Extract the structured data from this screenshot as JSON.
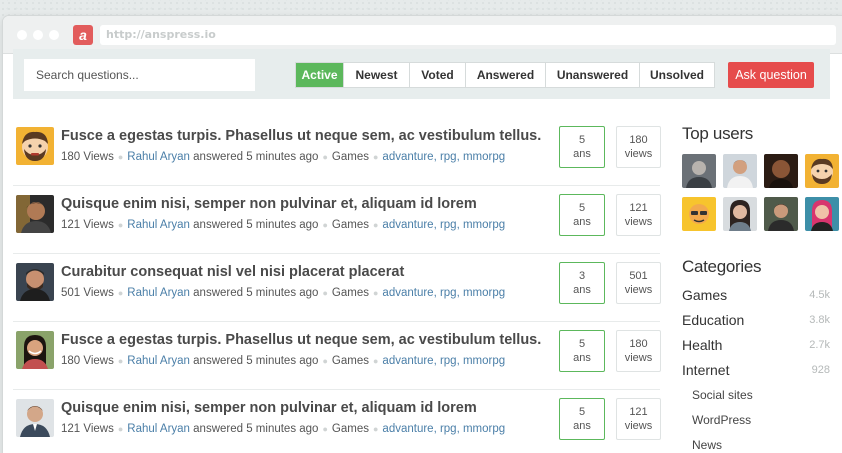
{
  "browser": {
    "url": "http://anspress.io",
    "favicon_letter": "a"
  },
  "toolbar": {
    "search_placeholder": "Search questions...",
    "tabs": [
      {
        "label": "Active",
        "active": true
      },
      {
        "label": "Newest",
        "active": false
      },
      {
        "label": "Voted",
        "active": false
      },
      {
        "label": "Answered",
        "active": false
      },
      {
        "label": "Unanswered",
        "active": false
      },
      {
        "label": "Unsolved",
        "active": false
      }
    ],
    "ask_label": "Ask question"
  },
  "questions": [
    {
      "title": "Fusce a egestas turpis. Phasellus ut neque sem, ac vestibulum tellus.",
      "views_text": "180 Views",
      "author": "Rahul Aryan",
      "action": "answered 5 minutes ago",
      "category": "Games",
      "tags": "advanture, rpg, mmorpg",
      "ans": "5",
      "ans_label": "ans",
      "views": "180",
      "views_label": "views",
      "avatar": "cartoon-face-icon"
    },
    {
      "title": "Quisque enim nisi, semper non pulvinar et, aliquam id lorem",
      "views_text": "121 Views",
      "author": "Rahul Aryan",
      "action": "answered 5 minutes ago",
      "category": "Games",
      "tags": "advanture, rpg, mmorpg",
      "ans": "5",
      "ans_label": "ans",
      "views": "121",
      "views_label": "views",
      "avatar": "man-avatar"
    },
    {
      "title": "Curabitur consequat nisl vel nisi placerat placerat",
      "views_text": "501 Views",
      "author": "Rahul Aryan",
      "action": "answered 5 minutes ago",
      "category": "Games",
      "tags": "advanture, rpg, mmorpg",
      "ans": "3",
      "ans_label": "ans",
      "views": "501",
      "views_label": "views",
      "avatar": "man-avatar"
    },
    {
      "title": "Fusce a egestas turpis. Phasellus ut neque sem, ac vestibulum tellus.",
      "views_text": "180 Views",
      "author": "Rahul Aryan",
      "action": "answered 5 minutes ago",
      "category": "Games",
      "tags": "advanture, rpg, mmorpg",
      "ans": "5",
      "ans_label": "ans",
      "views": "180",
      "views_label": "views",
      "avatar": "woman-avatar"
    },
    {
      "title": "Quisque enim nisi, semper non pulvinar et, aliquam id lorem",
      "views_text": "121 Views",
      "author": "Rahul Aryan",
      "action": "answered 5 minutes ago",
      "category": "Games",
      "tags": "advanture, rpg, mmorpg",
      "ans": "5",
      "ans_label": "ans",
      "views": "121",
      "views_label": "views",
      "avatar": "man-avatar"
    }
  ],
  "sidebar": {
    "top_users_title": "Top users",
    "categories_title": "Categories",
    "categories": [
      {
        "name": "Games",
        "count": "4.5k"
      },
      {
        "name": "Education",
        "count": "3.8k"
      },
      {
        "name": "Health",
        "count": "2.7k"
      },
      {
        "name": "Internet",
        "count": "928"
      }
    ],
    "subcategories": [
      "Social sites",
      "WordPress",
      "News"
    ]
  },
  "colors": {
    "accent_green": "#5cb85c",
    "ask_red": "#e64c4c",
    "link_blue": "#4b7fa8"
  }
}
